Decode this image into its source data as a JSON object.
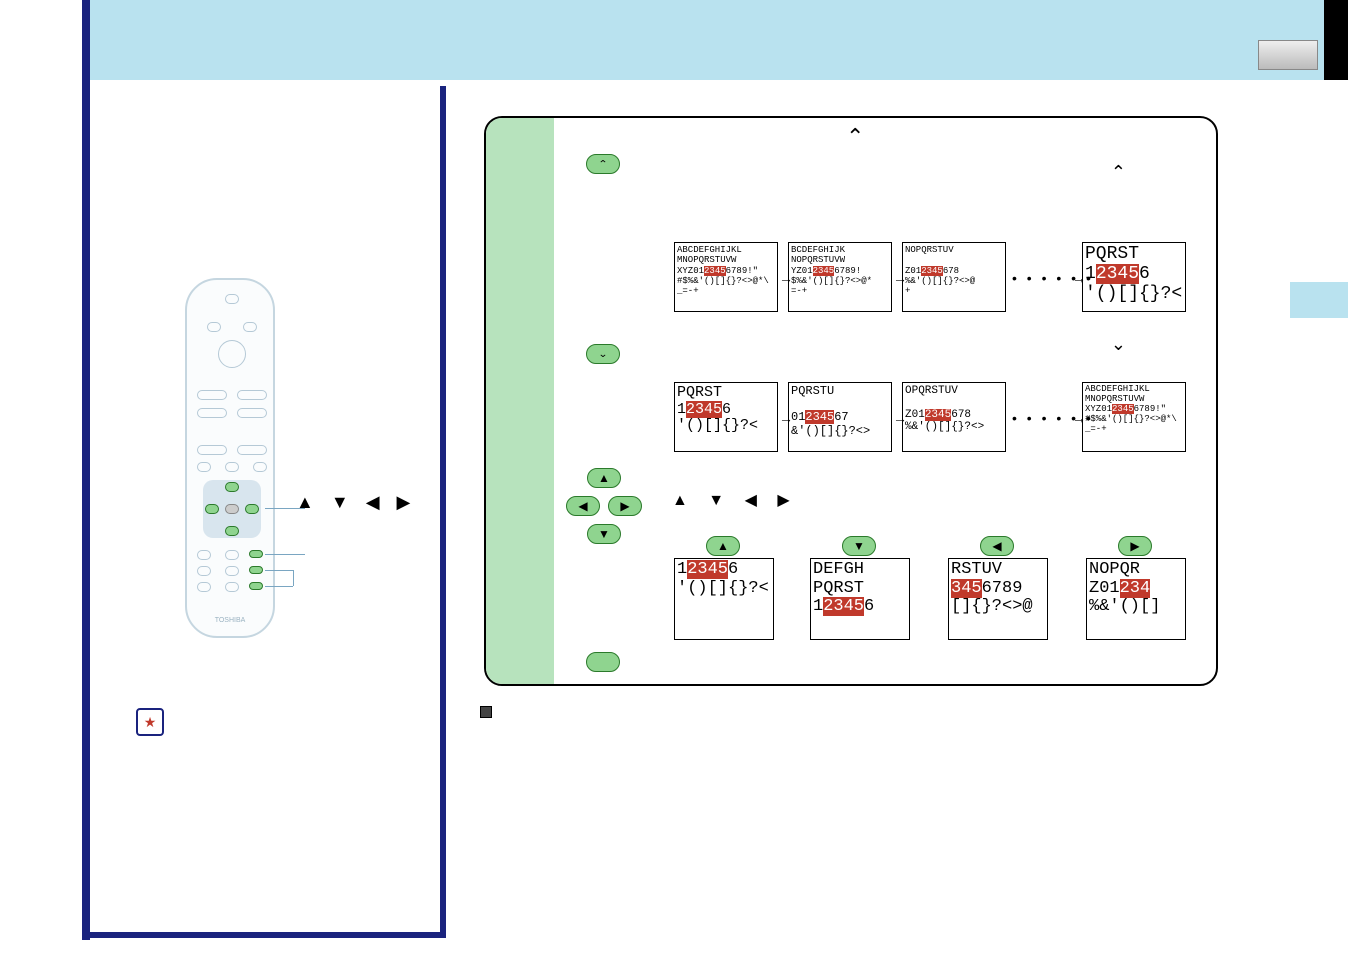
{
  "remote": {
    "brand": "TOSHIBA"
  },
  "misc": {
    "dots": "• • • • • •"
  },
  "grid": {
    "full": {
      "l1": "ABCDEFGHIJKL",
      "l2": "MNOPQRSTUVW",
      "l3a": "XYZ01",
      "l3h": "2345",
      "l3b": "6789!\"",
      "l4": "#$%&'()[]{}?<>@*\\",
      "l5": "_=-+"
    },
    "s1": {
      "l1": "BCDEFGHIJK",
      "l2": "NOPQRSTUVW",
      "l3a": "YZ01",
      "l3h": "2345",
      "l3b": "6789!",
      "l4": "$%&'()[]{}?<>@*",
      "l5": "=-+"
    },
    "s2": {
      "l1": "NOPQRSTUV",
      "l2": "",
      "l3a": "Z01",
      "l3h": "2345",
      "l3b": "678",
      "l4": "%&'()[]{}?<>@",
      "l5": "+"
    },
    "z": {
      "l1": "PQRST",
      "l2a": "1",
      "l2h": "2345",
      "l2b": "6",
      "l3": "'()[]{}?<"
    },
    "r1": {
      "l1": "PQRSTU",
      "l2": "",
      "l3a": "01",
      "l3h": "2345",
      "l3b": "67",
      "l4": "&'()[]{}?<>"
    },
    "r2": {
      "l1": "OPQRSTUV",
      "l2": "",
      "l3a": "Z01",
      "l3h": "2345",
      "l3b": "678",
      "l4": "%&'()[]{}?<>"
    }
  },
  "dir": {
    "up": {
      "l1a": "1",
      "l1h": "2345",
      "l1b": "6",
      "l2": "'()[]{}?<"
    },
    "down": {
      "l1": "DEFGH",
      "l2": "PQRST",
      "l3a": "1",
      "l3h": "2345",
      "l3b": "6"
    },
    "left": {
      "l1": "RSTUV",
      "l2h": "345",
      "l2b": "6789",
      "l3": "[]{}?<>@"
    },
    "right": {
      "l1": "NOPQR",
      "l2a": "Z01",
      "l2h": "234",
      "l3": "%&'()[]"
    }
  }
}
